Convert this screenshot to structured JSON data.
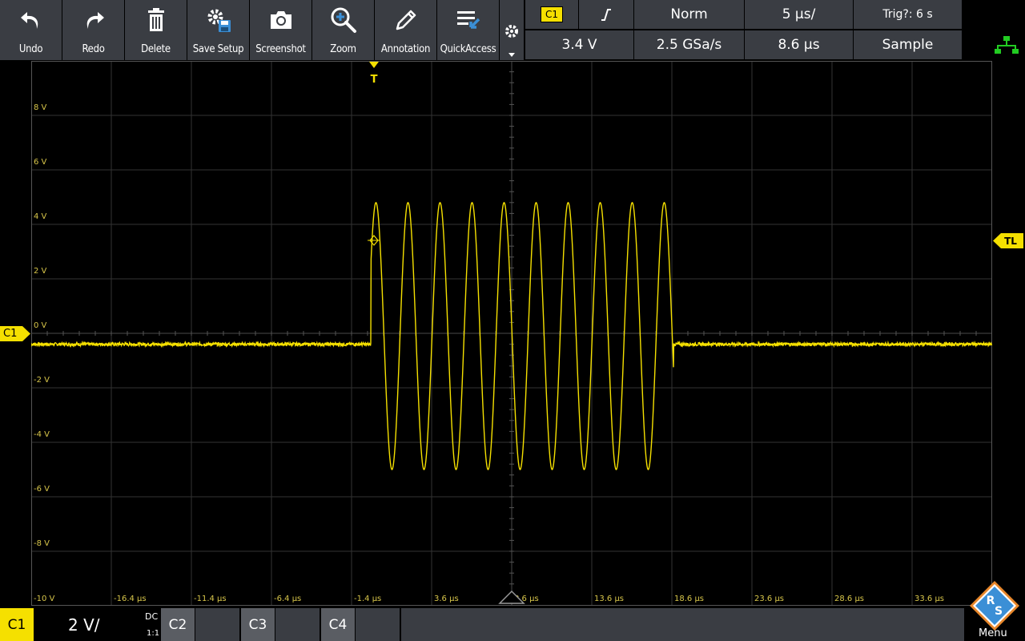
{
  "toolbar": {
    "buttons": [
      {
        "label": "Undo",
        "icon": "undo-icon"
      },
      {
        "label": "Redo",
        "icon": "redo-icon"
      },
      {
        "label": "Delete",
        "icon": "trash-icon"
      },
      {
        "label": "Save Setup",
        "icon": "save-setup-icon"
      },
      {
        "label": "Screenshot",
        "icon": "camera-icon"
      },
      {
        "label": "Zoom",
        "icon": "zoom-icon"
      },
      {
        "label": "Annotation",
        "icon": "pen-icon"
      },
      {
        "label": "QuickAccess",
        "icon": "quick-access-icon"
      }
    ]
  },
  "status": {
    "channel": "C1",
    "slope_icon": "rising-edge-icon",
    "trigger_mode": "Norm",
    "timebase": "5 µs/",
    "trig_status": "Trig?: 6 s",
    "trigger_level": "3.4 V",
    "sample_rate": "2.5 GSa/s",
    "horizontal_position": "8.6 µs",
    "acquisition_mode": "Sample"
  },
  "markers": {
    "trigger_time": "T",
    "trigger_level": "TL",
    "channel_offset": "C1"
  },
  "axes": {
    "y_labels": [
      "8 V",
      "6 V",
      "4 V",
      "2 V",
      "0 V",
      "-2 V",
      "-4 V",
      "-6 V",
      "-8 V",
      "-10 V"
    ],
    "x_labels": [
      "-16.4 µs",
      "-11.4 µs",
      "-6.4 µs",
      "-1.4 µs",
      "3.6 µs",
      "8.6 µs",
      "13.6 µs",
      "18.6 µs",
      "23.6 µs",
      "28.6 µs",
      "33.6 µs"
    ]
  },
  "bottom": {
    "c1_label": "C1",
    "c1_scale": "2 V/",
    "c1_coupling": "DC",
    "c1_probe": "1:1",
    "c2_label": "C2",
    "c3_label": "C3",
    "c4_label": "C4",
    "menu_label": "Menu"
  },
  "colors": {
    "trace": "#f5e000",
    "button_bg": "#3a3d43",
    "grid": "#3a3a3a",
    "network_icon": "#22cc22",
    "brand_blue": "#3b8fd6",
    "brand_orange": "#e8872b"
  },
  "chart_data": {
    "type": "line",
    "title": "",
    "xlabel": "",
    "ylabel": "",
    "xlim": [
      -21.4,
      38.6
    ],
    "ylim": [
      -10,
      10
    ],
    "x_unit": "µs",
    "y_unit": "V",
    "series": [
      {
        "signal": "sine burst",
        "baseline_V": -0.4,
        "burst_start_us": -0.2,
        "burst_end_us": 18.7,
        "cycles": 10,
        "frequency_MHz": 0.5,
        "peak_V": 4.8,
        "trough_V": -5.0
      }
    ]
  }
}
